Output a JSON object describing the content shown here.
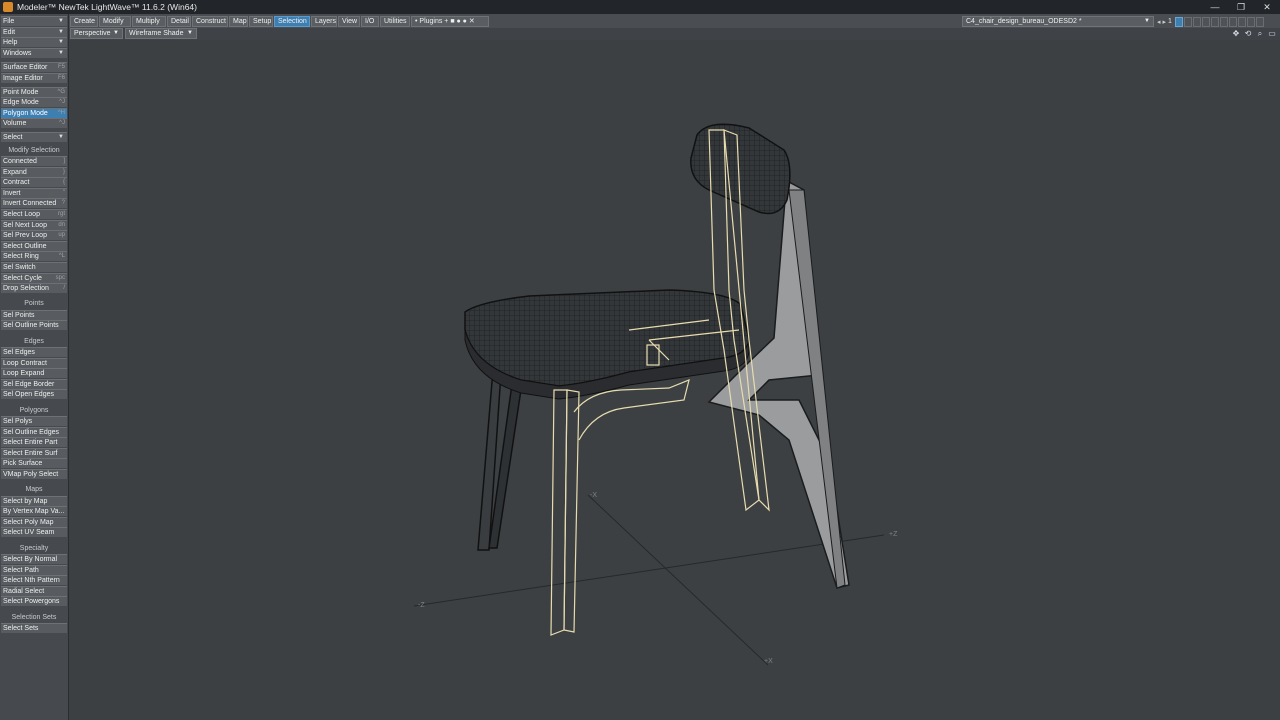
{
  "window": {
    "title": "Modeler™ NewTek LightWave™ 11.6.2 (Win64)",
    "controls": [
      "—",
      "❐",
      "✕"
    ]
  },
  "toolbar": {
    "tabs": [
      "Create",
      "Modify",
      "Multiply",
      "Detail",
      "Construct",
      "Map",
      "Setup",
      "Selection",
      "Layers",
      "View",
      "I/O",
      "Utilities",
      "• Plugins + ■ ● ● ✕"
    ],
    "active_tab": "Selection",
    "document": "C4_chair_design_bureau_ODESD2 *",
    "layer_number": "1"
  },
  "viewport_bar": {
    "view_mode": "Perspective",
    "shade_mode": "Wireframe Shade"
  },
  "sidebar": {
    "menus": [
      {
        "label": "File"
      },
      {
        "label": "Edit"
      },
      {
        "label": "Help"
      },
      {
        "label": "Windows"
      }
    ],
    "editors": [
      {
        "label": "Surface Editor",
        "hotkey": "F5"
      },
      {
        "label": "Image Editor",
        "hotkey": "F6"
      }
    ],
    "modes": [
      {
        "label": "Point Mode",
        "hotkey": "^G"
      },
      {
        "label": "Edge Mode",
        "hotkey": "^J"
      },
      {
        "label": "Polygon Mode",
        "hotkey": "^H"
      },
      {
        "label": "Volume",
        "hotkey": "^J"
      }
    ],
    "select_dropdown": "Select",
    "groups": [
      {
        "heading": "Modify Selection",
        "items": [
          {
            "label": "Connected",
            "hotkey": "]"
          },
          {
            "label": "Expand",
            "hotkey": "}"
          },
          {
            "label": "Contract",
            "hotkey": "{"
          },
          {
            "label": "Invert",
            "hotkey": "\""
          },
          {
            "label": "Invert Connected",
            "hotkey": "?"
          },
          {
            "label": "Select Loop",
            "hotkey": "rgt"
          },
          {
            "label": "Sel Next Loop",
            "hotkey": "dn"
          },
          {
            "label": "Sel Prev Loop",
            "hotkey": "up"
          },
          {
            "label": "Select Outline",
            "hotkey": ""
          },
          {
            "label": "Select Ring",
            "hotkey": "^L"
          },
          {
            "label": "Sel Switch",
            "hotkey": ""
          },
          {
            "label": "Select Cycle",
            "hotkey": "spc"
          },
          {
            "label": "Drop Selection",
            "hotkey": "/"
          }
        ]
      },
      {
        "heading": "Points",
        "items": [
          {
            "label": "Sel Points",
            "hotkey": ""
          },
          {
            "label": "Sel Outline Points",
            "hotkey": ""
          }
        ]
      },
      {
        "heading": "Edges",
        "items": [
          {
            "label": "Sel Edges",
            "hotkey": ""
          },
          {
            "label": "Loop Contract",
            "hotkey": ""
          },
          {
            "label": "Loop Expand",
            "hotkey": ""
          },
          {
            "label": "Sel Edge Border",
            "hotkey": ""
          },
          {
            "label": "Sel Open Edges",
            "hotkey": ""
          }
        ]
      },
      {
        "heading": "Polygons",
        "items": [
          {
            "label": "Sel Polys",
            "hotkey": ""
          },
          {
            "label": "Sel Outline Edges",
            "hotkey": ""
          },
          {
            "label": "Select Entire Part",
            "hotkey": ""
          },
          {
            "label": "Select Entire Surf",
            "hotkey": ""
          },
          {
            "label": "Pick Surface",
            "hotkey": ""
          },
          {
            "label": "VMap Poly Select",
            "hotkey": ""
          }
        ]
      },
      {
        "heading": "Maps",
        "items": [
          {
            "label": "Select by Map",
            "hotkey": ""
          },
          {
            "label": "By Vertex Map Va...",
            "hotkey": ""
          },
          {
            "label": "Select Poly Map",
            "hotkey": ""
          },
          {
            "label": "Select UV Seam",
            "hotkey": ""
          }
        ]
      },
      {
        "heading": "Specialty",
        "items": [
          {
            "label": "Select By Normal",
            "hotkey": ""
          },
          {
            "label": "Select Path",
            "hotkey": ""
          },
          {
            "label": "Select Nth Pattern",
            "hotkey": ""
          },
          {
            "label": "Radial Select",
            "hotkey": ""
          },
          {
            "label": "Select Powergons",
            "hotkey": ""
          }
        ]
      },
      {
        "heading": "Selection Sets",
        "items": [
          {
            "label": "Select Sets",
            "hotkey": ""
          }
        ]
      }
    ]
  },
  "axes": {
    "plus_x": "+X",
    "minus_x": "-X",
    "plus_z": "+Z",
    "minus_z": "-Z"
  },
  "colors": {
    "accent": "#3e7fb2",
    "selection": "#e8dcae",
    "mesh": "#2a2d30"
  }
}
